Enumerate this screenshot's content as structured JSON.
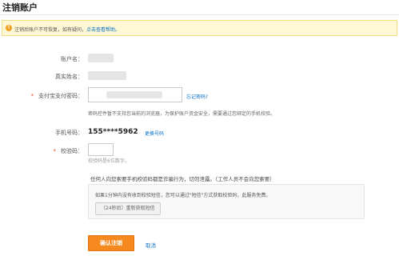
{
  "page": {
    "title": "注销账户"
  },
  "notice": {
    "icon": "info-icon",
    "text": "注销后账户不可恢复，如有疑问，",
    "link_text": "点击查看帮助。"
  },
  "form": {
    "account_label": "账户名：",
    "realname_label": "真实姓名：",
    "password": {
      "label": "支付宝支付密码：",
      "forgot_link": "忘记密码?",
      "note": "密码控件暂不支持您当前的浏览器，为保护账户资金安全，需要通过您绑定的手机校验。"
    },
    "phone": {
      "label": "手机号码：",
      "value": "155****5962",
      "change_link": "更换号码"
    },
    "code": {
      "label": "校验码：",
      "hint": "校验码是6位数字。"
    },
    "warning": "任何人向您索要手机校验码都是诈骗行为，切勿泄露。（工作人员不会向您索要）",
    "info": "如果1分钟内没有收到校验短信，您可以通过\"短信\"方式获取校验码，此服务免费。",
    "resend_button": "（24秒后）重新获取短信"
  },
  "actions": {
    "confirm": "确认注销",
    "cancel": "取消"
  },
  "colors": {
    "accent": "#f5891f",
    "link": "#0a6fc7",
    "notice_bg": "#fff8d5"
  }
}
